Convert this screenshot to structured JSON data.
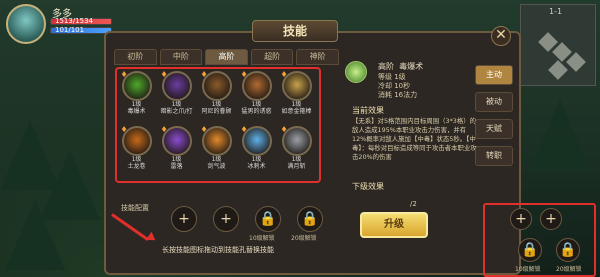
{
  "hud": {
    "player_name": "多多",
    "hp_text": "1513/1534",
    "mp_text": "101/101"
  },
  "minimap": {
    "label": "1-1"
  },
  "panel": {
    "title": "技能"
  },
  "tabs": [
    "初阶",
    "中阶",
    "高阶",
    "超阶",
    "神阶"
  ],
  "active_tab_index": 2,
  "skills": [
    {
      "lv": "1级",
      "name": "毒爆术",
      "color": "#4ea82a"
    },
    {
      "lv": "1级",
      "name": "暗影之爪/打",
      "color": "#6b3ca0"
    },
    {
      "lv": "1级",
      "name": "阿尼的眷顾",
      "color": "#8a5a2a"
    },
    {
      "lv": "1级",
      "name": "猛男的诱惑",
      "color": "#b06a30"
    },
    {
      "lv": "1级",
      "name": "如意金箍棒",
      "color": "#c8a24a"
    },
    {
      "lv": "1级",
      "name": "土龙卷",
      "color": "#c86a1a"
    },
    {
      "lv": "1级",
      "name": "雷落",
      "color": "#8b4bd0"
    },
    {
      "lv": "1级",
      "name": "剑气波",
      "color": "#e38a2a"
    },
    {
      "lv": "1级",
      "name": "冰刺术",
      "color": "#5fb0e8"
    },
    {
      "lv": "1级",
      "name": "满月斩",
      "color": "#9aa0a8"
    }
  ],
  "detail": {
    "level_tag": "高阶",
    "name": "毒爆术",
    "lines": [
      "等级 1级",
      "冷却 10秒",
      "消耗 16法力"
    ],
    "current_title": "当前效果",
    "current_desc": "【无系】对5格范围内目标周围（3*3格）的敌人造成195%本职业攻击力伤害，并有12%概率对敌人施加【中毒】状态5秒。【中毒】：每秒对目标造成等同于攻击者本职业攻击20%的伤害",
    "next_title": "下级效果",
    "next_fragment": "/2"
  },
  "upgrade_label": "升级",
  "side_tabs": [
    "主动",
    "被动",
    "天赋",
    "转职"
  ],
  "slots": {
    "label": "技能配置",
    "lock_10": "10级解锁",
    "lock_20": "20级解锁"
  },
  "hint": "长按技能图标拖动到技能孔替换技能",
  "right_panel": {
    "lock_10": "10级解锁",
    "lock_20": "20级解锁"
  }
}
